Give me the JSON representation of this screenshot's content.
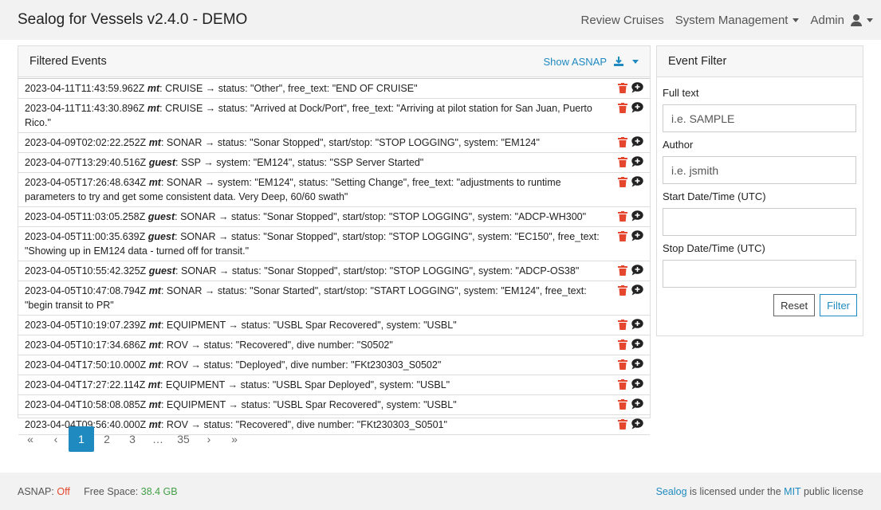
{
  "navbar": {
    "brand": "Sealog for Vessels v2.4.0 - DEMO",
    "review_cruises": "Review Cruises",
    "system_management": "System Management",
    "admin": "Admin"
  },
  "events_panel": {
    "title": "Filtered Events",
    "show_asnap": "Show ASNAP",
    "rows": [
      {
        "ts": "2023-04-11T11:43:59.962Z",
        "user": "mt",
        "type": "CRUISE",
        "text": "status: \"Other\", free_text: \"END OF CRUISE\""
      },
      {
        "ts": "2023-04-11T11:43:30.896Z",
        "user": "mt",
        "type": "CRUISE",
        "text": "status: \"Arrived at Dock/Port\", free_text: \"Arriving at pilot station for San Juan, Puerto Rico.\""
      },
      {
        "ts": "2023-04-09T02:02:22.252Z",
        "user": "mt",
        "type": "SONAR",
        "text": "status: \"Sonar Stopped\", start/stop: \"STOP LOGGING\", system: \"EM124\""
      },
      {
        "ts": "2023-04-07T13:29:40.516Z",
        "user": "guest",
        "type": "SSP",
        "text": "system: \"EM124\", status: \"SSP Server Started\""
      },
      {
        "ts": "2023-04-05T17:26:48.634Z",
        "user": "mt",
        "type": "SONAR",
        "text": "system: \"EM124\", status: \"Setting Change\", free_text: \"adjustments to runtime parameters to try and get some consistent data. Very Deep, 60/60 swath\""
      },
      {
        "ts": "2023-04-05T11:03:05.258Z",
        "user": "guest",
        "type": "SONAR",
        "text": "status: \"Sonar Stopped\", start/stop: \"STOP LOGGING\", system: \"ADCP-WH300\""
      },
      {
        "ts": "2023-04-05T11:00:35.639Z",
        "user": "guest",
        "type": "SONAR",
        "text": "status: \"Sonar Stopped\", start/stop: \"STOP LOGGING\", system: \"EC150\", free_text: \"Showing up in EM124 data - turned off for transit.\""
      },
      {
        "ts": "2023-04-05T10:55:42.325Z",
        "user": "guest",
        "type": "SONAR",
        "text": "status: \"Sonar Stopped\", start/stop: \"STOP LOGGING\", system: \"ADCP-OS38\""
      },
      {
        "ts": "2023-04-05T10:47:08.794Z",
        "user": "mt",
        "type": "SONAR",
        "text": "status: \"Sonar Started\", start/stop: \"START LOGGING\", system: \"EM124\", free_text: \"begin transit to PR\""
      },
      {
        "ts": "2023-04-05T10:19:07.239Z",
        "user": "mt",
        "type": "EQUIPMENT",
        "text": "status: \"USBL Spar Recovered\", system: \"USBL\""
      },
      {
        "ts": "2023-04-05T10:17:34.686Z",
        "user": "mt",
        "type": "ROV",
        "text": "status: \"Recovered\", dive number: \"S0502\""
      },
      {
        "ts": "2023-04-04T17:50:10.000Z",
        "user": "mt",
        "type": "ROV",
        "text": "status: \"Deployed\", dive number: \"FKt230303_S0502\""
      },
      {
        "ts": "2023-04-04T17:27:22.114Z",
        "user": "mt",
        "type": "EQUIPMENT",
        "text": "status: \"USBL Spar Deployed\", system: \"USBL\""
      },
      {
        "ts": "2023-04-04T10:58:08.085Z",
        "user": "mt",
        "type": "EQUIPMENT",
        "text": "status: \"USBL Spar Recovered\", system: \"USBL\""
      },
      {
        "ts": "2023-04-04T09:56:40.000Z",
        "user": "mt",
        "type": "ROV",
        "text": "status: \"Recovered\", dive number: \"FKt230303_S0501\""
      }
    ]
  },
  "pagination": {
    "first": "«",
    "prev": "‹",
    "pages": [
      "1",
      "2",
      "3",
      "…",
      "35"
    ],
    "active": "1",
    "next": "›",
    "last": "»"
  },
  "filter": {
    "title": "Event Filter",
    "full_text_label": "Full text",
    "full_text_placeholder": "i.e. SAMPLE",
    "author_label": "Author",
    "author_placeholder": "i.e. jsmith",
    "start_label": "Start Date/Time (UTC)",
    "stop_label": "Stop Date/Time (UTC)",
    "reset": "Reset",
    "filter": "Filter"
  },
  "footer": {
    "asnap_label": "ASNAP:",
    "asnap_value": "Off",
    "free_space_label": "Free Space:",
    "free_space_value": "38.4 GB",
    "license_app": "Sealog",
    "license_mid": "is licensed under the",
    "license_name": "MIT",
    "license_end": "public license"
  },
  "colors": {
    "accent": "#1f8ac0",
    "delete_icon": "#e5462e",
    "asnap_off": "#e5462e",
    "free_space": "#43a047"
  }
}
